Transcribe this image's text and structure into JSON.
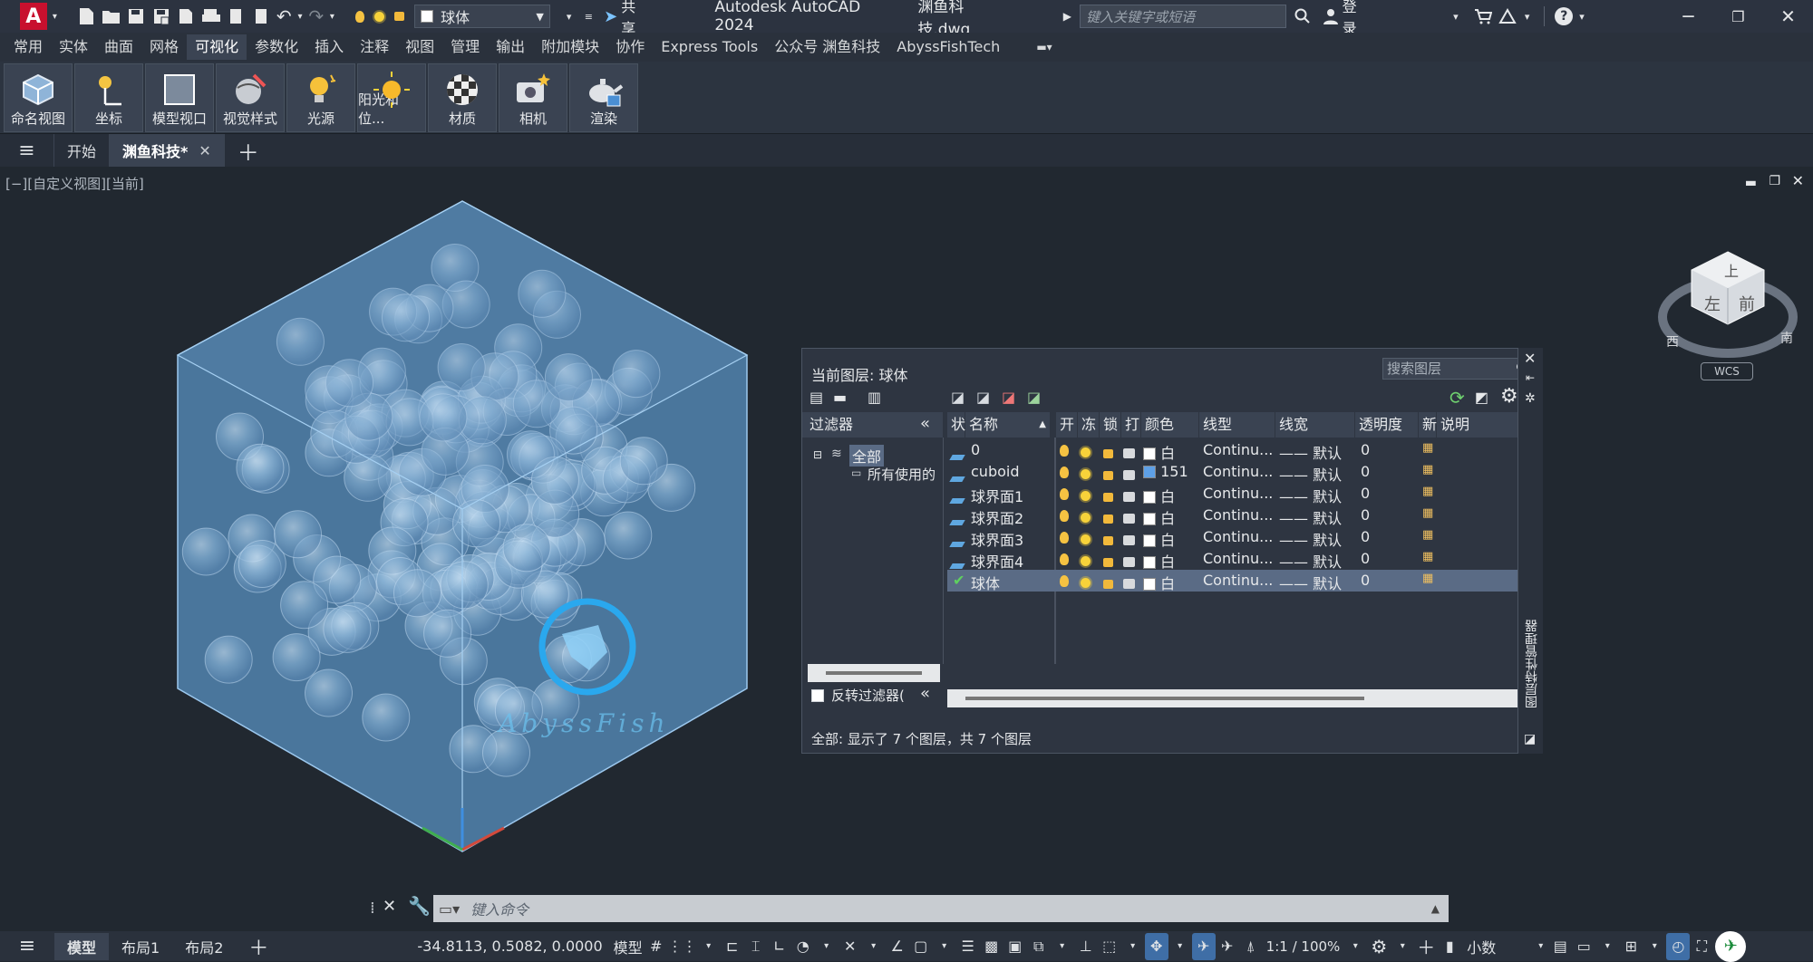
{
  "titlebar": {
    "app_logo": "A",
    "current_layer": "球体",
    "share_label": "共享",
    "window_title": "Autodesk AutoCAD 2024",
    "file_name": "渊鱼科技.dwg",
    "search_placeholder": "键入关键字或短语",
    "login_label": "登录"
  },
  "menu_tabs": [
    "常用",
    "实体",
    "曲面",
    "网格",
    "可视化",
    "参数化",
    "插入",
    "注释",
    "视图",
    "管理",
    "输出",
    "附加模块",
    "协作",
    "Express Tools",
    "公众号 渊鱼科技",
    "AbyssFishTech"
  ],
  "active_menu_tab": "可视化",
  "ribbon": {
    "buttons": [
      "命名视图",
      "坐标",
      "模型视口",
      "视觉样式",
      "光源",
      "阳光和位...",
      "材质",
      "相机",
      "渲染"
    ]
  },
  "file_tabs": {
    "start": "开始",
    "active": "渊鱼科技*"
  },
  "viewport": {
    "label": "[−][自定义视图][当前]",
    "watermark": "AbyssFish",
    "viewcube": {
      "top": "上",
      "left": "左",
      "front": "前",
      "west": "西",
      "south": "南",
      "wcs": "WCS"
    }
  },
  "layer_panel": {
    "current_layer_label": "当前图层: 球体",
    "search_placeholder": "搜索图层",
    "filter_title": "过滤器",
    "filter_all": "全部",
    "filter_used": "所有使用的",
    "invert_filter": "反转过滤器(",
    "side_title": "图层特性管理器",
    "columns": [
      "状",
      "名称",
      "开",
      "冻",
      "锁",
      "打",
      "颜色",
      "线型",
      "线宽",
      "透明度",
      "新",
      "说明"
    ],
    "layers": [
      {
        "name": "0",
        "color_name": "白",
        "color": "#ffffff",
        "linetype": "Continu...",
        "lineweight": "—— 默认",
        "transparency": "0",
        "current": false
      },
      {
        "name": "cuboid",
        "color_name": "151",
        "color": "#5ea0e6",
        "linetype": "Continu...",
        "lineweight": "—— 默认",
        "transparency": "0",
        "current": false
      },
      {
        "name": "球界面1",
        "color_name": "白",
        "color": "#ffffff",
        "linetype": "Continu...",
        "lineweight": "—— 默认",
        "transparency": "0",
        "current": false
      },
      {
        "name": "球界面2",
        "color_name": "白",
        "color": "#ffffff",
        "linetype": "Continu...",
        "lineweight": "—— 默认",
        "transparency": "0",
        "current": false
      },
      {
        "name": "球界面3",
        "color_name": "白",
        "color": "#ffffff",
        "linetype": "Continu...",
        "lineweight": "—— 默认",
        "transparency": "0",
        "current": false
      },
      {
        "name": "球界面4",
        "color_name": "白",
        "color": "#ffffff",
        "linetype": "Continu...",
        "lineweight": "—— 默认",
        "transparency": "0",
        "current": false
      },
      {
        "name": "球体",
        "color_name": "白",
        "color": "#ffffff",
        "linetype": "Continu...",
        "lineweight": "—— 默认",
        "transparency": "0",
        "current": true
      }
    ],
    "status_text": "全部: 显示了 7 个图层，共 7 个图层"
  },
  "command_line": {
    "placeholder": "键入命令"
  },
  "statusbar": {
    "tabs": [
      "模型",
      "布局1",
      "布局2"
    ],
    "active_tab": "模型",
    "coordinates": "-34.8113, 0.5082, 0.0000",
    "model_label": "模型",
    "scale": "1:1 / 100%",
    "units": "小数"
  }
}
